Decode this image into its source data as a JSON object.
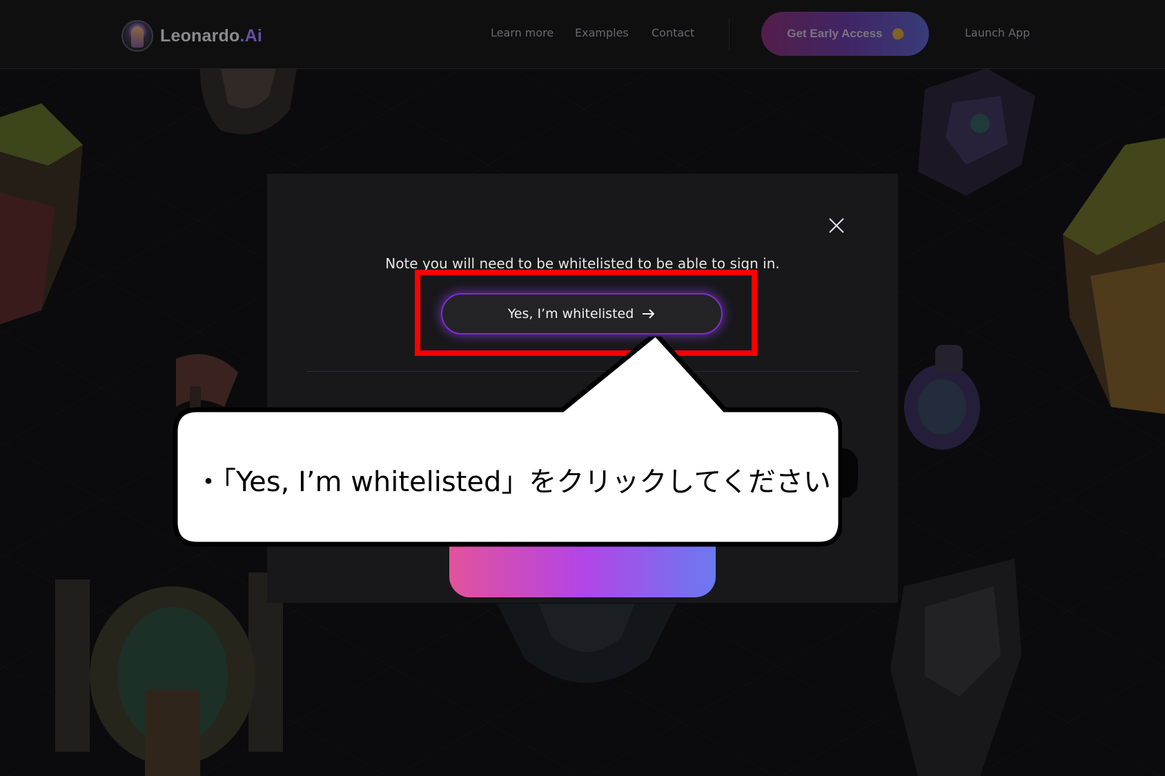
{
  "brand": {
    "name": "Leonardo",
    "suffix": ".Ai"
  },
  "nav": {
    "links": [
      "Learn more",
      "Examples",
      "Contact"
    ],
    "cta_label": "Get Early Access",
    "launch_label": "Launch App"
  },
  "modal": {
    "note": "Note you will need to be whitelisted to be able to sign in.",
    "whitelisted_button": "Yes, I’m whitelisted"
  },
  "annotation": {
    "callout_text": "・「Yes, I’m whitelisted」をクリックしてください"
  },
  "colors": {
    "background": "#121214",
    "modal": "#18181b",
    "accent_purple": "#7a2fd0",
    "highlight": "#ff0000",
    "cta_gradient": [
      "#8a2f7a",
      "#6a3aa6",
      "#5a62c9"
    ],
    "bottom_gradient": [
      "#e2539a",
      "#b344e6",
      "#6a7af0"
    ]
  },
  "icons": {
    "close": "close-icon",
    "arrow": "arrow-right-icon",
    "hand": "hand-wave-icon",
    "logo": "leonardo-logo-icon"
  }
}
